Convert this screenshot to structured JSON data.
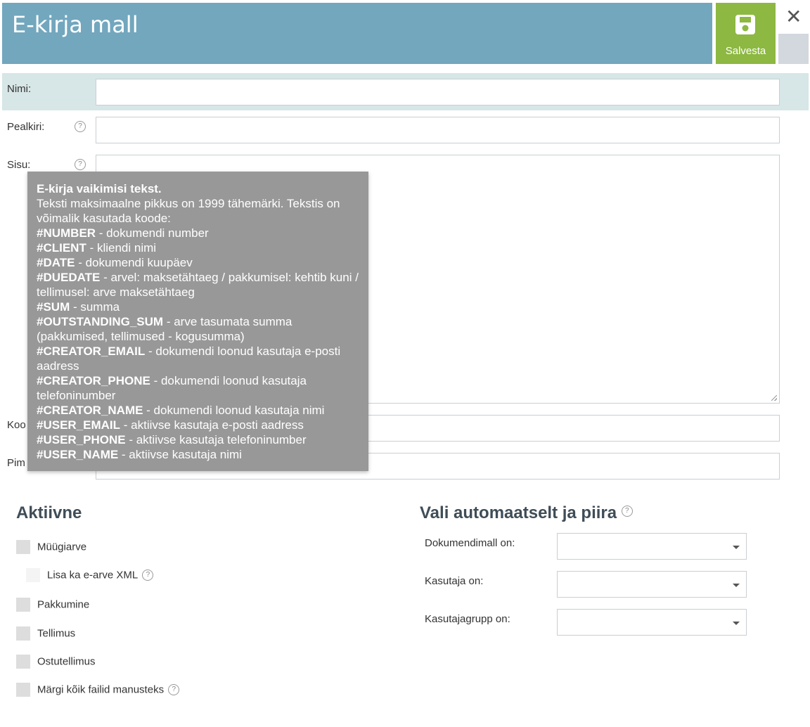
{
  "header": {
    "title": "E-kirja mall",
    "save_label": "Salvesta"
  },
  "form": {
    "name_label": "Nimi:",
    "name_value": "",
    "subject_label": "Pealkiri:",
    "subject_value": "",
    "body_label": "Sisu:",
    "body_value": "",
    "codes_label_partial": "Koo",
    "limit_label_partial": "Pim"
  },
  "tooltip": {
    "title": "E-kirja vaikimisi tekst.",
    "intro": "Teksti maksimaalne pikkus on 1999 tähemärki. Tekstis on võimalik kasutada koode:",
    "codes": [
      {
        "code": "#NUMBER",
        "desc": " - dokumendi number"
      },
      {
        "code": "#CLIENT",
        "desc": " - kliendi nimi"
      },
      {
        "code": "#DATE",
        "desc": " - dokumendi kuupäev"
      },
      {
        "code": "#DUEDATE",
        "desc": " - arvel: maksetähtaeg / pakkumisel: kehtib kuni / tellimusel: arve maksetähtaeg"
      },
      {
        "code": "#SUM",
        "desc": " - summa"
      },
      {
        "code": "#OUTSTANDING_SUM",
        "desc": " - arve tasumata summa (pakkumised, tellimused - kogusumma)"
      },
      {
        "code": "#CREATOR_EMAIL",
        "desc": " - dokumendi loonud kasutaja e-posti aadress"
      },
      {
        "code": "#CREATOR_PHONE",
        "desc": " - dokumendi loonud kasutaja telefoninumber"
      },
      {
        "code": "#CREATOR_NAME",
        "desc": " - dokumendi loonud kasutaja nimi"
      },
      {
        "code": "#USER_EMAIL",
        "desc": " - aktiivse kasutaja e-posti aadress"
      },
      {
        "code": "#USER_PHONE",
        "desc": " - aktiivse kasutaja telefoninumber"
      },
      {
        "code": "#USER_NAME",
        "desc": " - aktiivse kasutaja nimi"
      }
    ]
  },
  "active": {
    "title": "Aktiivne",
    "items": [
      {
        "label": "Müügiarve",
        "checked": false
      },
      {
        "label": "Lisa ka e-arve XML",
        "checked": false
      },
      {
        "label": "Pakkumine",
        "checked": false
      },
      {
        "label": "Tellimus",
        "checked": false
      },
      {
        "label": "Ostutellimus",
        "checked": false
      },
      {
        "label": "Märgi kõik failid manusteks",
        "checked": false
      }
    ]
  },
  "auto": {
    "title": "Vali automaatselt ja piira",
    "fields": [
      {
        "label": "Dokumendimall on:",
        "value": ""
      },
      {
        "label": "Kasutaja on:",
        "value": ""
      },
      {
        "label": "Kasutajagrupp on:",
        "value": ""
      }
    ]
  },
  "colors": {
    "header": "#72a7be",
    "save": "#8db842",
    "highlight_row": "#d7e6e6",
    "tooltip": "#989898"
  }
}
